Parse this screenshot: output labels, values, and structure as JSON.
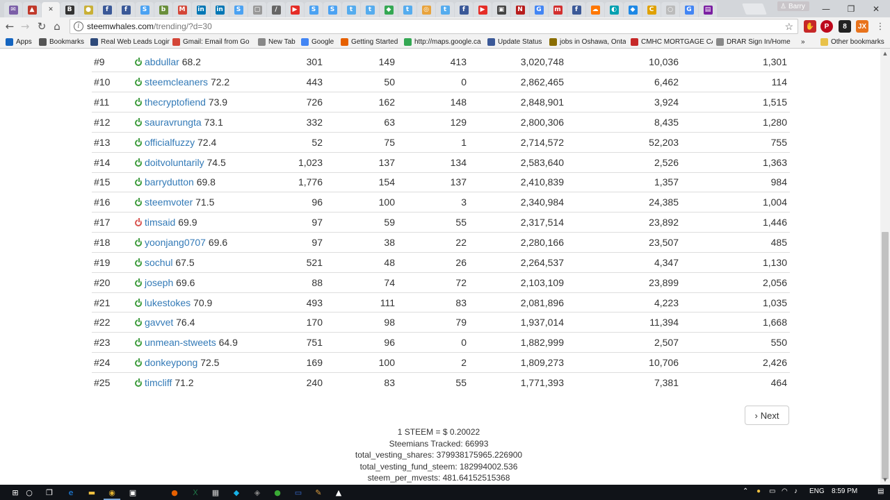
{
  "browser": {
    "tabs": [
      {
        "icon": "mail-icon",
        "color": "#7b5ea7",
        "glyph": "✉"
      },
      {
        "icon": "car-icon",
        "color": "#c0392b",
        "glyph": "▲"
      },
      {
        "icon": "close-icon",
        "color": "#f2f2f2",
        "glyph": "✕",
        "active": true
      },
      {
        "icon": "blogger-icon",
        "color": "#333333",
        "glyph": "B"
      },
      {
        "icon": "coin-icon",
        "color": "#c9b037",
        "glyph": "●"
      },
      {
        "icon": "facebook-icon",
        "color": "#3b5998",
        "glyph": "f"
      },
      {
        "icon": "facebook-icon",
        "color": "#3b5998",
        "glyph": "f"
      },
      {
        "icon": "steem-icon",
        "color": "#4ba2f2",
        "glyph": "S"
      },
      {
        "icon": "bw-icon",
        "color": "#6a8f3b",
        "glyph": "b"
      },
      {
        "icon": "gmail-icon",
        "color": "#d44638",
        "glyph": "M"
      },
      {
        "icon": "linkedin-icon",
        "color": "#0077b5",
        "glyph": "in"
      },
      {
        "icon": "linkedin-icon",
        "color": "#0077b5",
        "glyph": "in"
      },
      {
        "icon": "steem-icon",
        "color": "#4ba2f2",
        "glyph": "S"
      },
      {
        "icon": "page-icon",
        "color": "#999999",
        "glyph": "▢"
      },
      {
        "icon": "slash-icon",
        "color": "#666666",
        "glyph": "/"
      },
      {
        "icon": "youtube-icon",
        "color": "#e52d27",
        "glyph": "▶"
      },
      {
        "icon": "steem-icon",
        "color": "#4ba2f2",
        "glyph": "S"
      },
      {
        "icon": "steem-icon",
        "color": "#4ba2f2",
        "glyph": "S"
      },
      {
        "icon": "twitter-icon",
        "color": "#55acee",
        "glyph": "t"
      },
      {
        "icon": "twitter-icon",
        "color": "#55acee",
        "glyph": "t"
      },
      {
        "icon": "maps-icon",
        "color": "#34a853",
        "glyph": "◆"
      },
      {
        "icon": "twitter-icon",
        "color": "#55acee",
        "glyph": "t"
      },
      {
        "icon": "target-icon",
        "color": "#e8a33c",
        "glyph": "◎"
      },
      {
        "icon": "twitter-icon",
        "color": "#55acee",
        "glyph": "t"
      },
      {
        "icon": "facebook-icon",
        "color": "#3b5998",
        "glyph": "f"
      },
      {
        "icon": "youtube-icon",
        "color": "#e52d27",
        "glyph": "▶"
      },
      {
        "icon": "box-icon",
        "color": "#444444",
        "glyph": "▣"
      },
      {
        "icon": "news-icon",
        "color": "#b71c1c",
        "glyph": "N"
      },
      {
        "icon": "google-icon",
        "color": "#4285f4",
        "glyph": "G"
      },
      {
        "icon": "m-icon",
        "color": "#d32f2f",
        "glyph": "m"
      },
      {
        "icon": "facebook-icon",
        "color": "#3b5998",
        "glyph": "f"
      },
      {
        "icon": "soundcloud-icon",
        "color": "#ff7700",
        "glyph": "☁"
      },
      {
        "icon": "leaf-icon",
        "color": "#00a0b0",
        "glyph": "◐"
      },
      {
        "icon": "diamond-icon",
        "color": "#1e88e5",
        "glyph": "◆"
      },
      {
        "icon": "c-icon",
        "color": "#e0a100",
        "glyph": "C"
      },
      {
        "icon": "page-icon",
        "color": "#bbbbbb",
        "glyph": "○"
      },
      {
        "icon": "google-icon",
        "color": "#4285f4",
        "glyph": "G"
      },
      {
        "icon": "doc-icon",
        "color": "#7b1fa2",
        "glyph": "▤"
      }
    ],
    "user_chip": "Barry",
    "url_host": "steemwhales.com",
    "url_path": "/trending/?d=30"
  },
  "bookmarks": [
    {
      "label": "Apps",
      "icon": "apps-icon",
      "color": "#1565c0"
    },
    {
      "label": "Bookmarks",
      "icon": "star-icon",
      "color": "#555555"
    },
    {
      "label": "Real Web Leads Login",
      "icon": "leads-icon",
      "color": "#2e4a7a"
    },
    {
      "label": "Gmail: Email from Go",
      "icon": "gmail-icon",
      "color": "#d44638"
    },
    {
      "label": "New Tab",
      "icon": "page-icon",
      "color": "#888888"
    },
    {
      "label": "Google",
      "icon": "google-icon",
      "color": "#4285f4"
    },
    {
      "label": "Getting Started",
      "icon": "firefox-icon",
      "color": "#e66000"
    },
    {
      "label": "http://maps.google.ca",
      "icon": "maps-icon",
      "color": "#34a853"
    },
    {
      "label": "Update Status",
      "icon": "facebook-icon",
      "color": "#3b5998"
    },
    {
      "label": "jobs in Oshawa, Onta",
      "icon": "e-icon",
      "color": "#8a6d00"
    },
    {
      "label": "CMHC MORTGAGE CA",
      "icon": "arc-icon",
      "color": "#c62828"
    },
    {
      "label": "DRAR Sign In/Home",
      "icon": "page-icon",
      "color": "#888888"
    },
    {
      "label": "Other bookmarks",
      "icon": "folder-icon",
      "color": "#e8c14a"
    }
  ],
  "rows": [
    {
      "rank": "#9",
      "user": "abdullar",
      "rep": "68.2",
      "status": "online",
      "posts": "301",
      "followers": "149",
      "following": "413",
      "sp": "3,020,748",
      "votes": "10,036",
      "comments": "1,301"
    },
    {
      "rank": "#10",
      "user": "steemcleaners",
      "rep": "72.2",
      "status": "online",
      "posts": "443",
      "followers": "50",
      "following": "0",
      "sp": "2,862,465",
      "votes": "6,462",
      "comments": "114"
    },
    {
      "rank": "#11",
      "user": "thecryptofiend",
      "rep": "73.9",
      "status": "online",
      "posts": "726",
      "followers": "162",
      "following": "148",
      "sp": "2,848,901",
      "votes": "3,924",
      "comments": "1,515"
    },
    {
      "rank": "#12",
      "user": "sauravrungta",
      "rep": "73.1",
      "status": "online",
      "posts": "332",
      "followers": "63",
      "following": "129",
      "sp": "2,800,306",
      "votes": "8,435",
      "comments": "1,280"
    },
    {
      "rank": "#13",
      "user": "officialfuzzy",
      "rep": "72.4",
      "status": "online",
      "posts": "52",
      "followers": "75",
      "following": "1",
      "sp": "2,714,572",
      "votes": "52,203",
      "comments": "755"
    },
    {
      "rank": "#14",
      "user": "doitvoluntarily",
      "rep": "74.5",
      "status": "online",
      "posts": "1,023",
      "followers": "137",
      "following": "134",
      "sp": "2,583,640",
      "votes": "2,526",
      "comments": "1,363"
    },
    {
      "rank": "#15",
      "user": "barrydutton",
      "rep": "69.8",
      "status": "online",
      "posts": "1,776",
      "followers": "154",
      "following": "137",
      "sp": "2,410,839",
      "votes": "1,357",
      "comments": "984"
    },
    {
      "rank": "#16",
      "user": "steemvoter",
      "rep": "71.5",
      "status": "online",
      "posts": "96",
      "followers": "100",
      "following": "3",
      "sp": "2,340,984",
      "votes": "24,385",
      "comments": "1,004"
    },
    {
      "rank": "#17",
      "user": "timsaid",
      "rep": "69.9",
      "status": "offline",
      "posts": "97",
      "followers": "59",
      "following": "55",
      "sp": "2,317,514",
      "votes": "23,892",
      "comments": "1,446"
    },
    {
      "rank": "#18",
      "user": "yoonjang0707",
      "rep": "69.6",
      "status": "online",
      "posts": "97",
      "followers": "38",
      "following": "22",
      "sp": "2,280,166",
      "votes": "23,507",
      "comments": "485"
    },
    {
      "rank": "#19",
      "user": "sochul",
      "rep": "67.5",
      "status": "online",
      "posts": "521",
      "followers": "48",
      "following": "26",
      "sp": "2,264,537",
      "votes": "4,347",
      "comments": "1,130"
    },
    {
      "rank": "#20",
      "user": "joseph",
      "rep": "69.6",
      "status": "online",
      "posts": "88",
      "followers": "74",
      "following": "72",
      "sp": "2,103,109",
      "votes": "23,899",
      "comments": "2,056"
    },
    {
      "rank": "#21",
      "user": "lukestokes",
      "rep": "70.9",
      "status": "online",
      "posts": "493",
      "followers": "111",
      "following": "83",
      "sp": "2,081,896",
      "votes": "4,223",
      "comments": "1,035"
    },
    {
      "rank": "#22",
      "user": "gavvet",
      "rep": "76.4",
      "status": "online",
      "posts": "170",
      "followers": "98",
      "following": "79",
      "sp": "1,937,014",
      "votes": "11,394",
      "comments": "1,668"
    },
    {
      "rank": "#23",
      "user": "unmean-stweets",
      "rep": "64.9",
      "status": "online",
      "posts": "751",
      "followers": "96",
      "following": "0",
      "sp": "1,882,999",
      "votes": "2,507",
      "comments": "550"
    },
    {
      "rank": "#24",
      "user": "donkeypong",
      "rep": "72.5",
      "status": "online",
      "posts": "169",
      "followers": "100",
      "following": "2",
      "sp": "1,809,273",
      "votes": "10,706",
      "comments": "2,426"
    },
    {
      "rank": "#25",
      "user": "timcliff",
      "rep": "71.2",
      "status": "online",
      "posts": "240",
      "followers": "83",
      "following": "55",
      "sp": "1,771,393",
      "votes": "7,381",
      "comments": "464"
    }
  ],
  "pagination": {
    "next_label": "Next"
  },
  "stats": {
    "steem_price": "1 STEEM = $ 0.20022",
    "tracked": "Steemians Tracked: 66993",
    "total_vesting_shares": "total_vesting_shares: 379938175965.226900",
    "total_vesting_fund_steem": "total_vesting_fund_steem: 182994002.536",
    "steem_per_mvests": "steem_per_mvests: 481.64152515368"
  },
  "taskbar": {
    "apps": [
      {
        "icon": "windows-start-icon",
        "glyph": "⊞",
        "color": "#ffffff"
      },
      {
        "icon": "search-icon",
        "glyph": "○",
        "color": "#ffffff"
      },
      {
        "icon": "task-view-icon",
        "glyph": "❐",
        "color": "#ffffff"
      },
      {
        "icon": "edge-icon",
        "glyph": "e",
        "color": "#1e90ff"
      },
      {
        "icon": "file-explorer-icon",
        "glyph": "▬",
        "color": "#f0c040"
      },
      {
        "icon": "chrome-icon",
        "glyph": "◉",
        "color": "#e0b030",
        "active": true
      },
      {
        "icon": "store-icon",
        "glyph": "▣",
        "color": "#ffffff"
      },
      {
        "icon": "firefox-icon",
        "glyph": "●",
        "color": "#e66000"
      },
      {
        "icon": "excel-icon",
        "glyph": "X",
        "color": "#1e7145"
      },
      {
        "icon": "calculator-icon",
        "glyph": "▦",
        "color": "#cccccc"
      },
      {
        "icon": "kodi-icon",
        "glyph": "◆",
        "color": "#17b2e7"
      },
      {
        "icon": "app-icon",
        "glyph": "◈",
        "color": "#888888"
      },
      {
        "icon": "greenapp-icon",
        "glyph": "●",
        "color": "#3aaa35"
      },
      {
        "icon": "window-icon",
        "glyph": "▭",
        "color": "#3a6fd8"
      },
      {
        "icon": "paint-icon",
        "glyph": "✎",
        "color": "#e0a040"
      },
      {
        "icon": "photos-icon",
        "glyph": "▲",
        "color": "#ffffff"
      }
    ],
    "language": "ENG",
    "time": "8:59 PM"
  }
}
